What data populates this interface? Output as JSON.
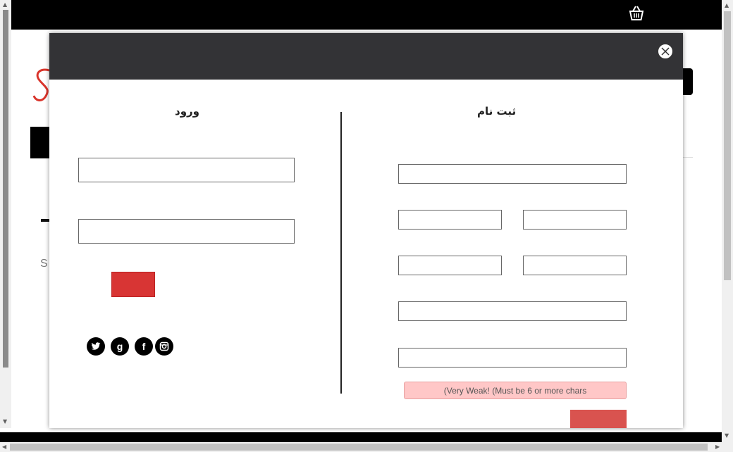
{
  "background": {
    "logo_letter": "S",
    "snippet_text": "S"
  },
  "modal": {
    "login_title": "ورود",
    "register_title": "ثبت نام",
    "login": {
      "username_value": "",
      "password_value": ""
    },
    "register": {
      "field_1_value": "",
      "field_2a_value": "",
      "field_2b_value": "",
      "field_3a_value": "",
      "field_3b_value": "",
      "field_4_value": "",
      "field_5_value": "",
      "password_strength": "(Very Weak! (Must be 6 or more chars"
    },
    "social": [
      "twitter-icon",
      "google-icon",
      "facebook-icon",
      "instagram-icon"
    ],
    "social_labels": {
      "google": "g",
      "facebook": "f"
    }
  },
  "colors": {
    "header": "#333336",
    "login_button": "#d83534",
    "register_button": "#d9534f",
    "strength_bg": "#ffc7c7",
    "logo": "#d9342b"
  }
}
